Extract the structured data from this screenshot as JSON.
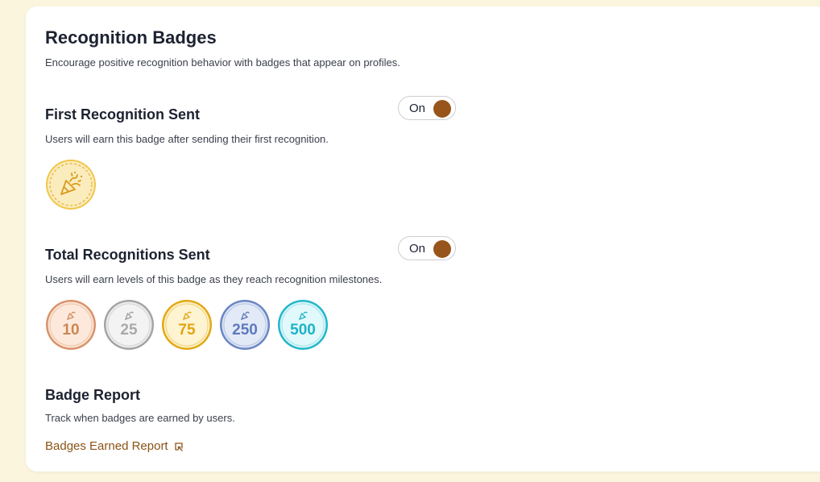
{
  "header": {
    "title": "Recognition Badges",
    "subtitle": "Encourage positive recognition behavior with badges that appear on profiles."
  },
  "first_recognition": {
    "title": "First Recognition Sent",
    "description": "Users will earn this badge after sending their first recognition.",
    "toggle_label": "On",
    "toggle_on": true,
    "badge_icon": "party-popper-icon"
  },
  "total_recognitions": {
    "title": "Total Recognitions Sent",
    "description": "Users will earn levels of this badge as they reach recognition milestones.",
    "toggle_label": "On",
    "toggle_on": true,
    "levels": [
      {
        "value": "10",
        "tier": "bronze",
        "color": "#d28a5c"
      },
      {
        "value": "25",
        "tier": "silver",
        "color": "#9a9a9a"
      },
      {
        "value": "75",
        "tier": "gold",
        "color": "#e0a412"
      },
      {
        "value": "250",
        "tier": "sapphire",
        "color": "#5b78b8"
      },
      {
        "value": "500",
        "tier": "diamond",
        "color": "#1fb4c8"
      }
    ]
  },
  "badge_report": {
    "title": "Badge Report",
    "description": "Track when badges are earned by users.",
    "link_label": "Badges Earned Report",
    "link_icon": "external-link-icon"
  },
  "colors": {
    "accent": "#97551b",
    "link": "#8a5316",
    "background": "#fbf5de"
  }
}
